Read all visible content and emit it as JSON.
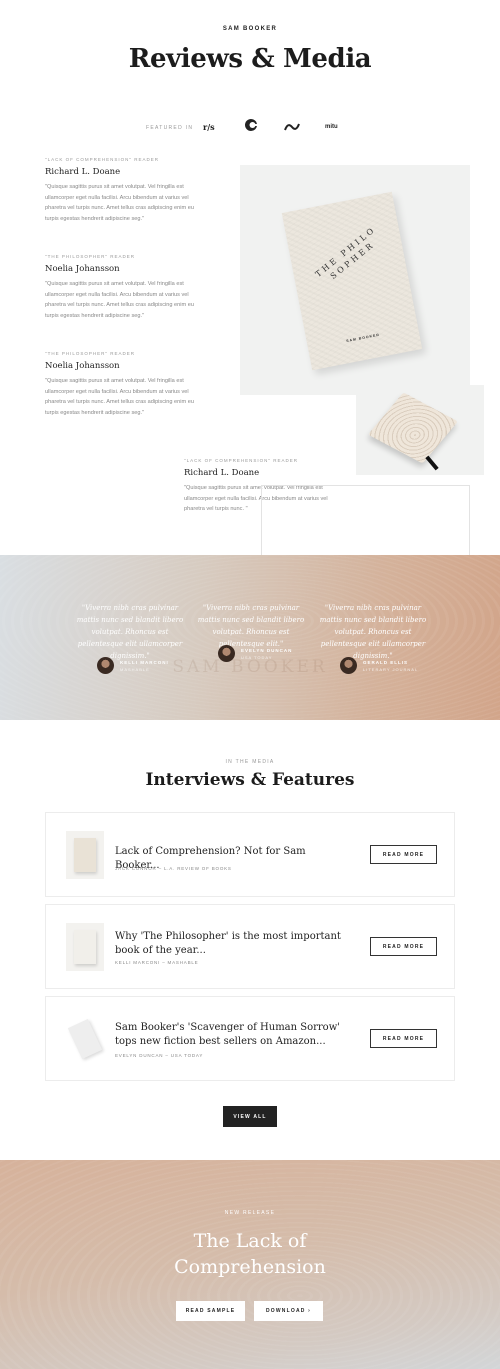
{
  "header": {
    "author": "SAM BOOKER",
    "title": "Reviews & Media",
    "featured_label": "FEATURED IN",
    "logos": [
      {
        "name": "r/s",
        "icon": "rs-logo"
      },
      {
        "name": "e",
        "icon": "e-logo"
      },
      {
        "name": "~",
        "icon": "wave-logo"
      },
      {
        "name": "mitu",
        "icon": "mitu-logo"
      }
    ]
  },
  "reviews": [
    {
      "tag": "\"LACK OF COMPREHENSION\" READER",
      "name": "Richard L. Doane",
      "quote": "\"Quisque sagittis purus sit amet volutpat. Vel fringilla est ullamcorper eget nulla facilisi. Arcu bibendum at varius vel pharetra vel turpis nunc. Amet tellus cras adipiscing enim eu turpis egestas hendrerit adipiscine seg.\""
    },
    {
      "tag": "\"THE PHILOSOPHER\" READER",
      "name": "Noelia Johansson",
      "quote": "\"Quisque sagittis purus sit amet volutpat. Vel fringilla est ullamcorper eget nulla facilisi. Arcu bibendum at varius vel pharetra vel turpis nunc. Amet tellus cras adipiscing enim eu turpis egestas hendrerit adipiscine seg.\""
    },
    {
      "tag": "\"THE PHILOSOPHER\" READER",
      "name": "Noelia Johansson",
      "quote": "\"Quisque sagittis purus sit amet volutpat. Vel fringilla est ullamcorper eget nulla facilisi. Arcu bibendum at varius vel pharetra vel turpis nunc. Amet tellus cras adipiscing enim eu turpis egestas hendrerit adipiscine seg.\""
    },
    {
      "tag": "\"LACK OF COMPREHENSION\" READER",
      "name": "Richard L. Doane",
      "quote": "\"Quisque sagittis purus sit amet volutpat. Vel fringilla est ullamcorper eget nulla facilisi. Arcu bibendum at varius vel pharetra vel turpis nunc. \""
    }
  ],
  "book": {
    "title": "THE PHILO SOPHER",
    "author": "SAM BOOKER"
  },
  "testimonials": {
    "watermark": "SAM BOOKER",
    "items": [
      {
        "quote": "\"Viverra nibh cras pulvinar mattis nunc sed blandit libero volutpat. Rhoncus est pellentesque elit ullamcorper dignissim.\"",
        "name": "KELLI MARCONI",
        "outlet": "MASHABLE"
      },
      {
        "quote": "\"Viverra nibh cras pulvinar mattis nunc sed blandit libero volutpat. Rhoncus est pellentesque elit.\"",
        "name": "EVELYN DUNCAN",
        "outlet": "USA TODAY"
      },
      {
        "quote": "\"Viverra nibh cras pulvinar mattis nunc sed blandit libero volutpat. Rhoncus est pellentesque elit ullamcorper dignissim.\"",
        "name": "GERALD ELLIS",
        "outlet": "LITERARY JOURNAL"
      }
    ]
  },
  "media": {
    "eyebrow": "IN THE MEDIA",
    "title": "Interviews & Features",
    "read_more_label": "READ MORE",
    "view_all_label": "VIEW ALL",
    "items": [
      {
        "headline": "Lack of Comprehension? Not for Sam Booker...",
        "meta": "JACK CONNOR – L.A. REVIEW OF BOOKS"
      },
      {
        "headline": "Why 'The Philosopher' is the most important book of the year...",
        "meta": "KELLI MARCONI – MASHABLE"
      },
      {
        "headline": "Sam Booker's 'Scavenger of Human Sorrow' tops new fiction best sellers on Amazon...",
        "meta": "EVELYN DUNCAN – USA TODAY"
      }
    ]
  },
  "release": {
    "eyebrow": "NEW RELEASE",
    "title": "The Lack of Comprehension",
    "read_sample": "READ SAMPLE",
    "download": "DOWNLOAD ›"
  }
}
